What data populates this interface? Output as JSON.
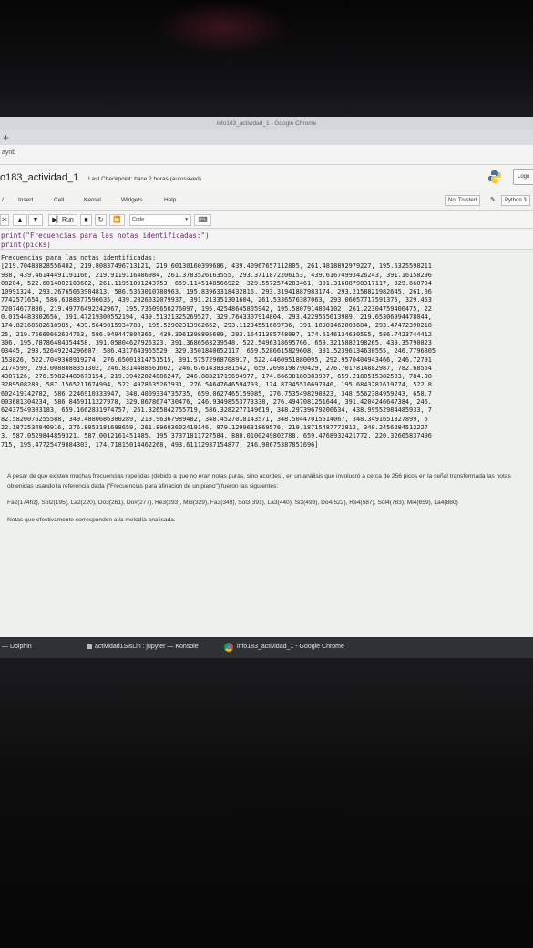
{
  "window": {
    "title": "info183_actividad_1 - Google Chrome",
    "bookmark": "aynb"
  },
  "notebook": {
    "name": "o183_actividad_1",
    "checkpoint": "Last Checkpoint: hace 2 horas",
    "save_status": "(autosaved)",
    "logout_label": "Logo"
  },
  "menu": {
    "items": [
      "Insert",
      "Cell",
      "Kernel",
      "Widgets",
      "Help"
    ],
    "trusted": "Not Trusted",
    "kernel": "Python 3"
  },
  "toolbar": {
    "run_label": "Run",
    "cell_type": "Code"
  },
  "cell": {
    "code": "print(\"Frecuencias para las notas identificadas:\")\nprint(picks)"
  },
  "output": {
    "text": "Frecuencias para las notas identificadas:\n[219.70483828556402, 219.80837496713121, 219.60130160399686, 439.40967657112805, 261.4818892979227, 195.6325598211\n938, 439.46144491191166, 219.9119116486984, 261.3783526163555, 293.3711872206153, 439.61674993426243, 391.16158296\n08204, 522.6014002103602, 261.11951091243753, 659.1145148566922, 329.5572574283461, 391.31688798317117, 329.660794\n10991324, 293.26765053904813, 586.5353010780963, 195.83963318432816, 293.31941887983174, 293.2158821982645, 261.06\n7742571654, 586.6388377596635, 439.2026032079937, 391.213351301604, 261.5336576387063, 293.06057717591375, 329.453\n72074677886, 219.49776492242967, 195.73609650276097, 195.42548645805942, 195.5807914804102, 261.22304759400475, 22\n0.0154483302656, 391.47219300552194, 439.51321325269527, 329.7643307914804, 293.4229555613989, 219.65306994478044,\n174.82168682618985, 439.5649815934788, 195.52902313962662, 293.11234551669736, 391.10981462003684, 293.47472390218\n25, 219.75660662634763, 586.949447804365, 439.3061398895609, 293.16411385748097, 174.61461346305S5, 586.7423744412\n306, 195.78786484354458, 391.05804627925323, 391.3686563239548, 522.5496318695766, 659.3215882198265, 439.35790823\n03445, 293.52649224296607, 586.4317643965529, 329.3501840652117, 659.5286615829608, 391.52396134630555, 246.7796805\n153826, 522.7049368919274, 276.65001314751515, 391.57572968708917, 522.4460951880095, 292.9570404943466, 246.72791\n2174599, 293.0088088351302, 246.8314488561662, 246.67614383381542, 659.2698198790429, 276.7017814882987, 782.68554\n4307126, 276.59824480673154, 219.39422824086247, 246.88321719694977, 174.66638180383907, 659.2180515382593, 784.08\n3289508283, 587.1565211674994, 522.4978635267931, 276.54647646594793, 174.87345516697346, 195.6843281619774, 522.8\n602419142782, 586.2246910333947, 348.4009334735735, 659.0627465159085, 276.7535498290823, 348.5562384959243, 658.7\n003681304234, 586.8459111227978, 329.8678674730476, 246.93498553773338, 276.4947081251644, 391.4204246647384, 246.\n62437549303183, 659.1662831974757, 261.3265842755719, 586.3282277149619, 348.29739679200634, 438.99552984485933, 7\n82.5820076255588, 349.4880686300289, 219.96367989482, 348.4527018143571, 348.50447015514067, 348.3491651327899, 5\n22.1872534840916, 276.8053181698659, 261.89603602419146, 879.1299631869576, 219.18715487772812, 348.2456284512227\n3, 587.0529844859321, 587.0012161451485, 195.37371811727584, 880.0100249802788, 659.4768932421772, 220.32605837496\n715, 195.47725479884303, 174.71815014462268, 493.61112937154877, 246.98675387851696]"
  },
  "markdown": {
    "p1": "A pesar de que existen muchas frecuencias repetidas (debido a que no eran notas puras, sino acordes), en un análisis que involucró a cerca de 256 picos en la señal transformada las notas obtenidas usando la referencia dada (\"Frecuencias para afinacion de un piano\") fueron las siguientes:",
    "p2": "Fa2(174hz), Sol2(195), La2(220), Do3(261), Do#(277), Re3(293), Mi3(329), Fa3(349), Sol3(391), La3(440), Si3(493), Do4(522), Re4(587), Sol4(783), Mi4(659), La4(880)",
    "p3": "Notas que efectivamente corresponden a la melodía analisada."
  },
  "taskbar": {
    "item1": "— Dolphin",
    "item2": "actividad1SisLin : jupyter — Konsole",
    "item3": "info183_actividad_1 - Google Chrome"
  }
}
